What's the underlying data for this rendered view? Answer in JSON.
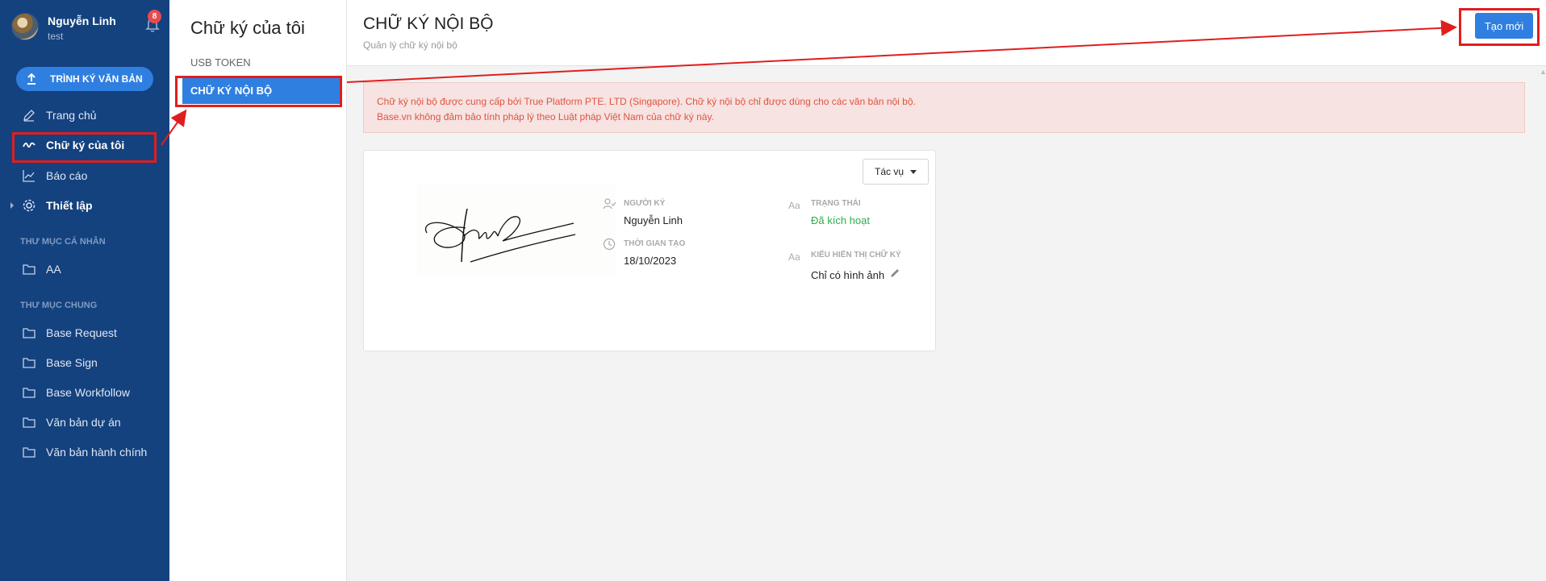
{
  "user": {
    "name": "Nguyễn Linh",
    "subtitle": "test",
    "notification_count": "8"
  },
  "sidebar": {
    "upload_label": "TRÌNH KÝ VĂN BẢN",
    "items": [
      {
        "label": "Trang chủ",
        "icon": "pen-icon"
      },
      {
        "label": "Chữ ký của tôi",
        "icon": "signature-icon"
      },
      {
        "label": "Báo cáo",
        "icon": "chart-icon"
      },
      {
        "label": "Thiết lập",
        "icon": "gear-icon"
      }
    ],
    "personal_section": "THƯ MỤC CÁ NHÂN",
    "personal_folders": [
      {
        "label": "AA",
        "icon": "folder-icon"
      }
    ],
    "shared_section": "THƯ MỤC CHUNG",
    "shared_folders": [
      {
        "label": "Base Request",
        "icon": "folder-icon"
      },
      {
        "label": "Base Sign",
        "icon": "folder-icon"
      },
      {
        "label": "Base Workfollow",
        "icon": "folder-icon"
      },
      {
        "label": "Văn bản dự án",
        "icon": "folder-icon"
      },
      {
        "label": "Văn bản hành chính",
        "icon": "folder-icon"
      }
    ]
  },
  "subnav": {
    "title": "Chữ ký của tôi",
    "items": [
      {
        "label": "USB TOKEN"
      },
      {
        "label": "CHỮ KÝ NỘI BỘ"
      }
    ]
  },
  "header": {
    "title": "CHỮ KÝ NỘI BỘ",
    "subtitle": "Quản lý chữ ký nội bộ",
    "new_button": "Tạo mới"
  },
  "notice": {
    "line1": "Chữ ký nội bộ được cung cấp bởi True Platform PTE. LTD (Singapore). Chữ ký nội bộ chỉ được dùng cho các văn bản nội bộ.",
    "line2": "Base.vn không đảm bảo tính pháp lý theo Luật pháp Việt Nam của chữ ký này."
  },
  "card": {
    "action_label": "Tác vụ",
    "signer_label": "NGƯỜI KÝ",
    "signer_value": "Nguyễn Linh",
    "status_label": "TRẠNG THÁI",
    "status_value": "Đã kích hoạt",
    "created_label": "THỜI GIAN TẠO",
    "created_value": "18/10/2023",
    "display_label": "KIỂU HIỂN THỊ CHỮ KÝ",
    "display_value": "Chỉ có hình ảnh",
    "aa_glyph": "Aa"
  },
  "colors": {
    "sidebar": "#14427f",
    "accent": "#2f7fe0",
    "success": "#2db04b",
    "warning_text": "#e0533f",
    "annotation": "#e01e1e"
  }
}
